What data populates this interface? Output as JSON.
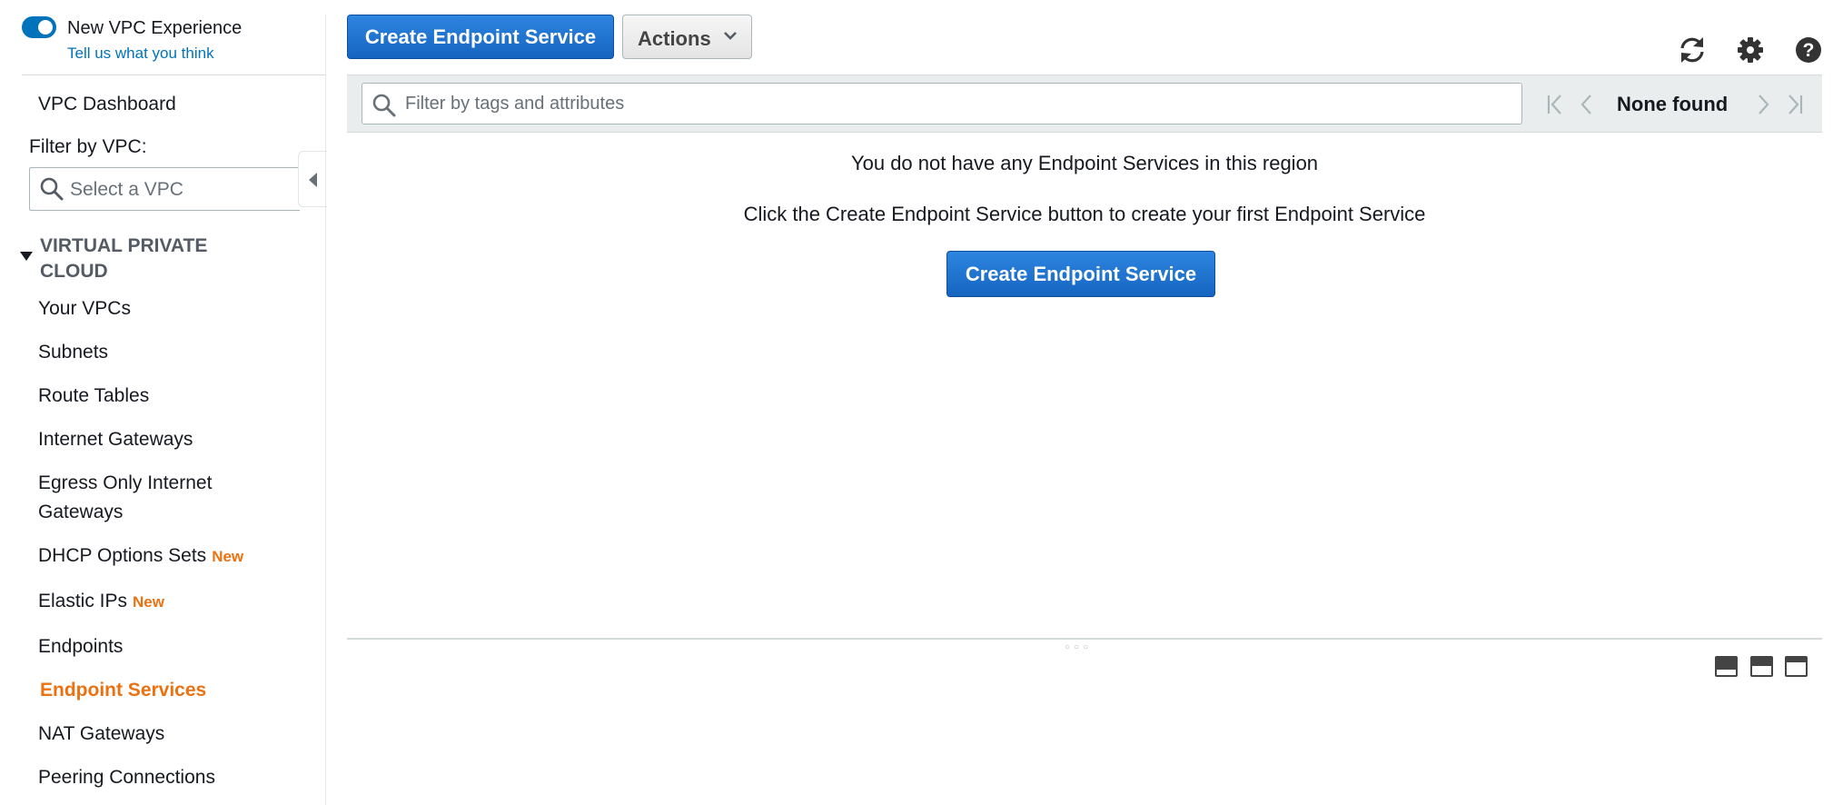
{
  "sidebar": {
    "toggle_label": "New VPC Experience",
    "feedback_link": "Tell us what you think",
    "dashboard_link": "VPC Dashboard",
    "filter_label": "Filter by VPC:",
    "vpc_select_placeholder": "Select a VPC",
    "section_title": "VIRTUAL PRIVATE CLOUD",
    "items": [
      {
        "label": "Your VPCs"
      },
      {
        "label": "Subnets"
      },
      {
        "label": "Route Tables"
      },
      {
        "label": "Internet Gateways"
      },
      {
        "label": "Egress Only Internet Gateways"
      },
      {
        "label": "DHCP Options Sets",
        "badge": "New"
      },
      {
        "label": "Elastic IPs",
        "badge": "New"
      },
      {
        "label": "Endpoints"
      },
      {
        "label": "Endpoint Services",
        "active": true
      },
      {
        "label": "NAT Gateways"
      },
      {
        "label": "Peering Connections"
      }
    ]
  },
  "toolbar": {
    "create_button": "Create Endpoint Service",
    "actions_button": "Actions",
    "icons": [
      "refresh-icon",
      "settings-gear-icon",
      "help-icon"
    ]
  },
  "filter": {
    "placeholder": "Filter by tags and attributes",
    "pagination_text": "None found"
  },
  "empty_state": {
    "title": "You do not have any Endpoint Services in this region",
    "description": "Click the Create Endpoint Service button to create your first Endpoint Service",
    "create_button": "Create Endpoint Service"
  },
  "detail_pane": {
    "layout_icons": [
      "layout-bottom-pane-icon",
      "layout-split-pane-icon",
      "layout-top-pane-icon"
    ]
  },
  "colors": {
    "accent_blue": "#1565c0",
    "link_blue": "#0073bb",
    "active_orange": "#ec7211",
    "filter_bar_bg": "#eaeded"
  }
}
